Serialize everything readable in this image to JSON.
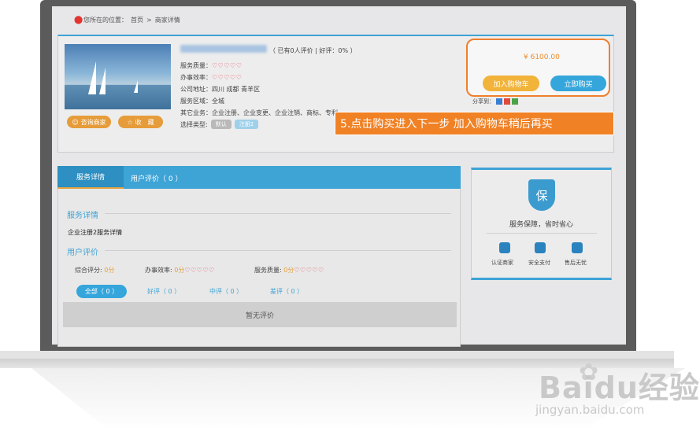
{
  "breadcrumb": {
    "prefix": "您所在的位置：",
    "home": "首页",
    "sep": " > ",
    "current": "商家详情"
  },
  "merchant": {
    "stats": "（ 已有0人评价 | 好评：0% ）",
    "service_quality_label": "服务质量：",
    "efficiency_label": "办事效率：",
    "hearts": "♡♡♡♡♡",
    "address": "公司地址：四川 成都 青羊区",
    "area": "服务区域：全城",
    "other_business": "其它业务：企业注册、企业变更、企业注销、商标、专利",
    "choose_type": "选择类型:",
    "type_default": "默认",
    "type_selected": "注册2",
    "consult_btn": "咨询商家",
    "favorite_btn": "收　藏"
  },
  "purchase": {
    "price": "¥ 6100.00",
    "add_cart": "加入购物车",
    "buy_now": "立即购买",
    "share_label": "分享到："
  },
  "callout": "5.点击购买进入下一步 加入购物车稍后再买",
  "tabs": {
    "service": "服务详情",
    "reviews": "用户评价（ 0 ）"
  },
  "detail": {
    "section_service": "服务详情",
    "service_text": "企业注册2服务详情",
    "section_reviews": "用户评价",
    "overall_label": "综合评分:",
    "overall_val": "0分",
    "eff_label": "办事效率:",
    "eff_val": "0分",
    "quality_label": "服务质量:",
    "quality_val": "0分",
    "filter_all": "全部（ 0 ）",
    "filter_good": "好评（ 0 ）",
    "filter_mid": "中评（ 0 ）",
    "filter_bad": "差评（ 0 ）",
    "no_reviews": "暂无评价"
  },
  "guarantee": {
    "icon_text": "保",
    "title": "服务保障，省时省心",
    "items": [
      "认证商家",
      "安全支付",
      "售后无忧"
    ]
  },
  "watermark": {
    "brand": "Baidu经验",
    "url": "jingyan.baidu.com"
  }
}
